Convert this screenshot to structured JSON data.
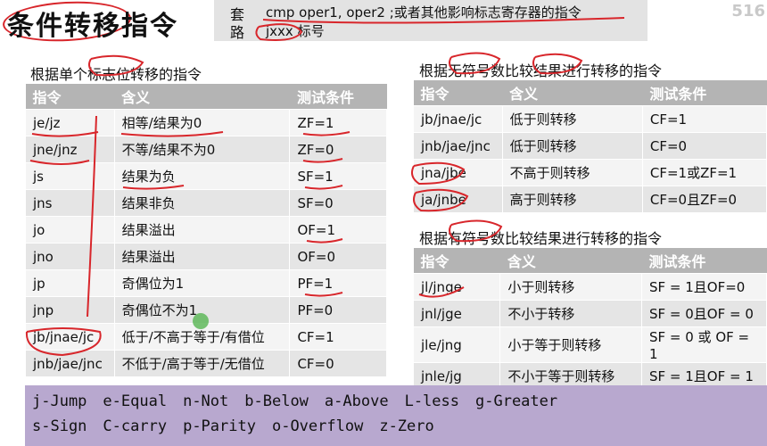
{
  "title": "条件转移指令",
  "taolu": {
    "k1": "套",
    "k2": "路",
    "line1": "cmp oper1, oper2 ;或者其他影响标志寄存器的指令",
    "line2": "jxxx 标号"
  },
  "page_number": "516",
  "left": {
    "heading": "根据单个标志位转移的指令",
    "headers": [
      "指令",
      "含义",
      "测试条件"
    ],
    "rows": [
      [
        "je/jz",
        "相等/结果为0",
        "ZF=1"
      ],
      [
        "jne/jnz",
        "不等/结果不为0",
        "ZF=0"
      ],
      [
        "js",
        "结果为负",
        "SF=1"
      ],
      [
        "jns",
        "结果非负",
        "SF=0"
      ],
      [
        "jo",
        "结果溢出",
        "OF=1"
      ],
      [
        "jno",
        "结果溢出",
        "OF=0"
      ],
      [
        "jp",
        "奇偶位为1",
        "PF=1"
      ],
      [
        "jnp",
        "奇偶位不为1",
        "PF=0"
      ],
      [
        "jb/jnae/jc",
        "低于/不高于等于/有借位",
        "CF=1"
      ],
      [
        "jnb/jae/jnc",
        "不低于/高于等于/无借位",
        "CF=0"
      ]
    ]
  },
  "right_top": {
    "heading": "根据无符号数比较结果进行转移的指令",
    "headers": [
      "指令",
      "含义",
      "测试条件"
    ],
    "rows": [
      [
        "jb/jnae/jc",
        "低于则转移",
        "CF=1"
      ],
      [
        "jnb/jae/jnc",
        "低于则转移",
        "CF=0"
      ],
      [
        "jna/jbe",
        "不高于则转移",
        "CF=1或ZF=1"
      ],
      [
        "ja/jnbe",
        "高于则转移",
        "CF=0且ZF=0"
      ]
    ]
  },
  "right_bottom": {
    "heading": "根据有符号数比较结果进行转移的指令",
    "headers": [
      "指令",
      "含义",
      "测试条件"
    ],
    "rows": [
      [
        "jl/jnge",
        "小于则转移",
        "SF = 1且OF=0"
      ],
      [
        "jnl/jge",
        "不小于转移",
        "SF = 0且OF = 0"
      ],
      [
        "jle/jng",
        "小于等于则转移",
        "SF = 0 或 OF = 1"
      ],
      [
        "jnle/jg",
        "不小于等于则转移",
        "SF = 1且OF = 1"
      ]
    ]
  },
  "legend": {
    "row1": [
      "j-Jump",
      "e-Equal",
      "n-Not",
      "b-Below",
      "a-Above",
      "L-less",
      "g-Greater"
    ],
    "row2": [
      "s-Sign",
      "C-carry",
      "p-Parity",
      "o-Overflow",
      "z-Zero"
    ]
  },
  "colors": {
    "annotation": "#d8262b",
    "header_bg": "#b4b4b4",
    "legend_bg": "#b8a8cf"
  }
}
